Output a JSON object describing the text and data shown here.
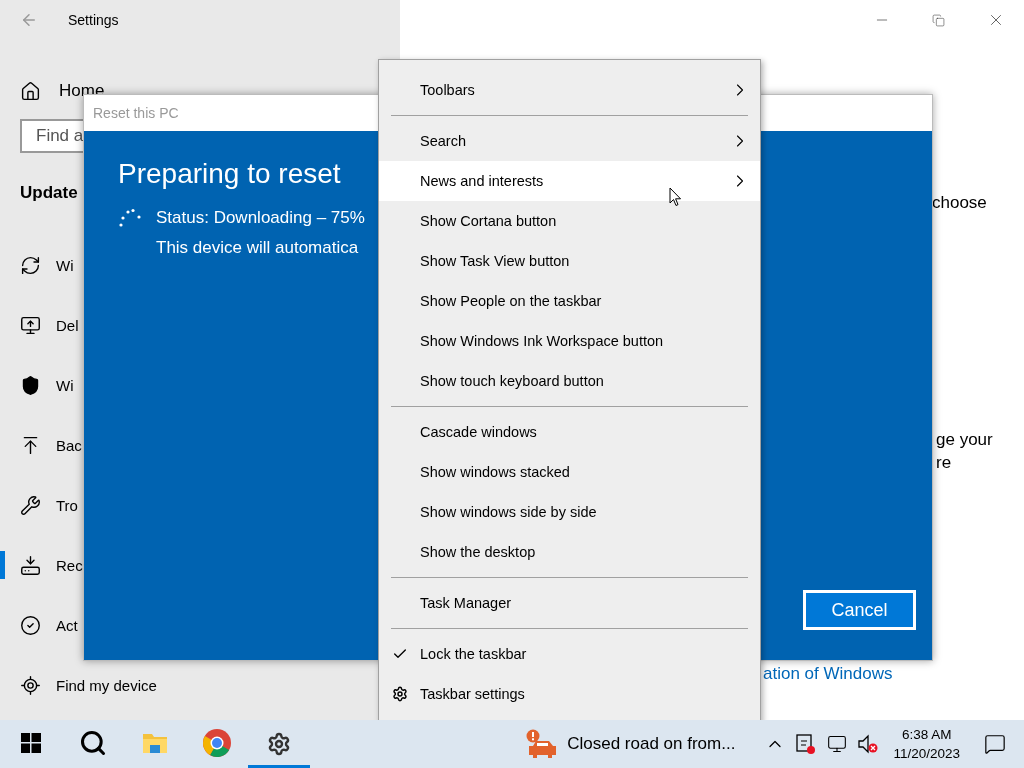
{
  "settings_window": {
    "title": "Settings",
    "sidebar": {
      "home": "Home",
      "search_placeholder": "Find a",
      "section": "Update",
      "items": [
        {
          "label": "Wi",
          "selected": false
        },
        {
          "label": "Del",
          "selected": false
        },
        {
          "label": "Wi",
          "selected": false
        },
        {
          "label": "Bac",
          "selected": false
        },
        {
          "label": "Tro",
          "selected": false
        },
        {
          "label": "Rec",
          "selected": true
        },
        {
          "label": "Act",
          "selected": false
        },
        {
          "label": "Find my device",
          "selected": false
        }
      ]
    },
    "content": {
      "text_1": "choose",
      "text_2": [
        "ge your",
        "re"
      ],
      "link": "ation of Windows"
    }
  },
  "dialog": {
    "title": "Reset this PC",
    "heading": "Preparing to reset",
    "status": "Status: Downloading – 75%",
    "note": "This device will automatica",
    "button": "Cancel"
  },
  "context_menu": {
    "items": [
      {
        "kind": "item",
        "label": "Toolbars",
        "submenu": true,
        "checked": false,
        "selected": false
      },
      {
        "kind": "separator"
      },
      {
        "kind": "item",
        "label": "Search",
        "submenu": true,
        "checked": false,
        "selected": false
      },
      {
        "kind": "item",
        "label": "News and interests",
        "submenu": true,
        "checked": false,
        "selected": true
      },
      {
        "kind": "item",
        "label": "Show Cortana button",
        "submenu": false,
        "checked": false,
        "selected": false
      },
      {
        "kind": "item",
        "label": "Show Task View button",
        "submenu": false,
        "checked": false,
        "selected": false
      },
      {
        "kind": "item",
        "label": "Show People on the taskbar",
        "submenu": false,
        "checked": false,
        "selected": false
      },
      {
        "kind": "item",
        "label": "Show Windows Ink Workspace button",
        "submenu": false,
        "checked": false,
        "selected": false
      },
      {
        "kind": "item",
        "label": "Show touch keyboard button",
        "submenu": false,
        "checked": false,
        "selected": false
      },
      {
        "kind": "separator"
      },
      {
        "kind": "item",
        "label": "Cascade windows",
        "submenu": false,
        "checked": false,
        "selected": false
      },
      {
        "kind": "item",
        "label": "Show windows stacked",
        "submenu": false,
        "checked": false,
        "selected": false
      },
      {
        "kind": "item",
        "label": "Show windows side by side",
        "submenu": false,
        "checked": false,
        "selected": false
      },
      {
        "kind": "item",
        "label": "Show the desktop",
        "submenu": false,
        "checked": false,
        "selected": false
      },
      {
        "kind": "separator"
      },
      {
        "kind": "item",
        "label": "Task Manager",
        "submenu": false,
        "checked": false,
        "selected": false
      },
      {
        "kind": "separator"
      },
      {
        "kind": "item",
        "label": "Lock the taskbar",
        "submenu": false,
        "checked": true,
        "selected": false
      },
      {
        "kind": "settings",
        "label": "Taskbar settings",
        "submenu": false,
        "checked": false,
        "selected": false
      }
    ]
  },
  "taskbar": {
    "apps": [
      {
        "active": false
      },
      {
        "active": false
      },
      {
        "active": false
      },
      {
        "active": false
      },
      {
        "active": true
      }
    ],
    "news": "Closed road on from...",
    "time": "6:38 AM",
    "date": "11/20/2023"
  }
}
